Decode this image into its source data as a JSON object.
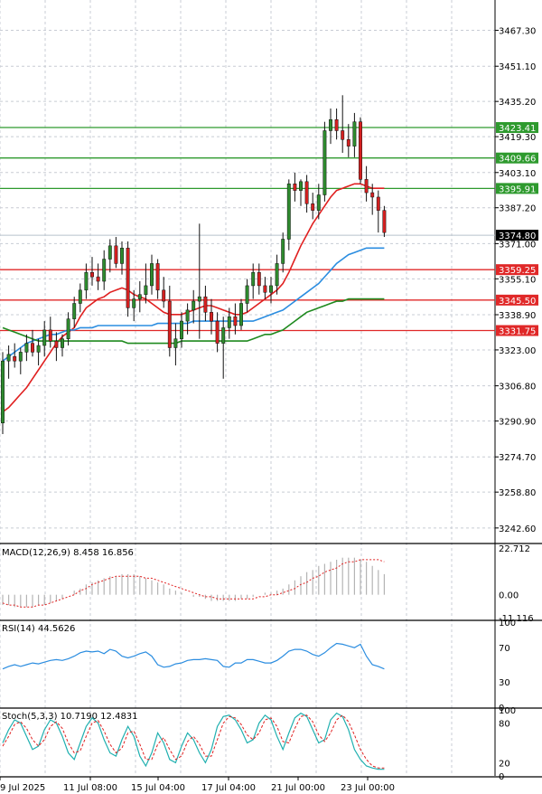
{
  "chart_data": {
    "type": "candlestick",
    "price_axis": {
      "ticks": [
        "3467.30",
        "3451.10",
        "3435.20",
        "3419.30",
        "3403.10",
        "3387.20",
        "3371.00",
        "3355.10",
        "3338.90",
        "3323.00",
        "3306.80",
        "3290.90",
        "3274.70",
        "3258.80",
        "3242.60"
      ],
      "min": 3236,
      "max": 3481
    },
    "current_price": "3374.80",
    "x_axis": {
      "labels": [
        "9 Jul 2025",
        "11 Jul 08:00",
        "15 Jul 04:00",
        "17 Jul 04:00",
        "21 Jul 00:00",
        "23 Jul 00:00"
      ]
    },
    "grid": true,
    "levels": [
      {
        "value": 3423.41,
        "label": "3423.41",
        "color": "#2e9a2e"
      },
      {
        "value": 3409.66,
        "label": "3409.66",
        "color": "#2e9a2e"
      },
      {
        "value": 3395.91,
        "label": "3395.91",
        "color": "#2e9a2e"
      },
      {
        "value": 3359.25,
        "label": "3359.25",
        "color": "#e02828"
      },
      {
        "value": 3345.5,
        "label": "3345.50",
        "color": "#e02828"
      },
      {
        "value": 3331.75,
        "label": "3331.75",
        "color": "#e02828"
      }
    ],
    "candles": [
      [
        3290,
        3322,
        3285,
        3318
      ],
      [
        3318,
        3325,
        3310,
        3321
      ],
      [
        3320,
        3326,
        3315,
        3318
      ],
      [
        3318,
        3324,
        3312,
        3322
      ],
      [
        3322,
        3330,
        3318,
        3326
      ],
      [
        3326,
        3332,
        3320,
        3322
      ],
      [
        3322,
        3328,
        3316,
        3325
      ],
      [
        3325,
        3336,
        3320,
        3332
      ],
      [
        3332,
        3338,
        3324,
        3327
      ],
      [
        3327,
        3331,
        3318,
        3324
      ],
      [
        3324,
        3330,
        3320,
        3328
      ],
      [
        3328,
        3340,
        3325,
        3337
      ],
      [
        3337,
        3347,
        3333,
        3344
      ],
      [
        3344,
        3353,
        3340,
        3350
      ],
      [
        3350,
        3362,
        3346,
        3358
      ],
      [
        3358,
        3365,
        3352,
        3356
      ],
      [
        3356,
        3362,
        3350,
        3354
      ],
      [
        3354,
        3368,
        3350,
        3364
      ],
      [
        3364,
        3373,
        3358,
        3370
      ],
      [
        3370,
        3374,
        3360,
        3362
      ],
      [
        3362,
        3372,
        3357,
        3369
      ],
      [
        3369,
        3372,
        3338,
        3342
      ],
      [
        3342,
        3350,
        3336,
        3346
      ],
      [
        3346,
        3354,
        3340,
        3348
      ],
      [
        3348,
        3362,
        3344,
        3352
      ],
      [
        3352,
        3366,
        3348,
        3362
      ],
      [
        3362,
        3364,
        3346,
        3350
      ],
      [
        3350,
        3356,
        3342,
        3345
      ],
      [
        3345,
        3352,
        3320,
        3324
      ],
      [
        3324,
        3335,
        3316,
        3328
      ],
      [
        3328,
        3340,
        3324,
        3336
      ],
      [
        3336,
        3344,
        3330,
        3341
      ],
      [
        3341,
        3350,
        3335,
        3345
      ],
      [
        3345,
        3380,
        3328,
        3347
      ],
      [
        3347,
        3352,
        3336,
        3340
      ],
      [
        3340,
        3346,
        3330,
        3336
      ],
      [
        3336,
        3340,
        3322,
        3326
      ],
      [
        3326,
        3338,
        3310,
        3333
      ],
      [
        3333,
        3342,
        3328,
        3338
      ],
      [
        3338,
        3344,
        3330,
        3334
      ],
      [
        3334,
        3346,
        3332,
        3344
      ],
      [
        3344,
        3355,
        3340,
        3352
      ],
      [
        3352,
        3362,
        3346,
        3358
      ],
      [
        3358,
        3362,
        3348,
        3352
      ],
      [
        3352,
        3356,
        3346,
        3349
      ],
      [
        3349,
        3356,
        3344,
        3352
      ],
      [
        3352,
        3366,
        3348,
        3362
      ],
      [
        3362,
        3376,
        3358,
        3373
      ],
      [
        3373,
        3400,
        3368,
        3398
      ],
      [
        3398,
        3403,
        3390,
        3395
      ],
      [
        3395,
        3400,
        3388,
        3399
      ],
      [
        3399,
        3402,
        3385,
        3389
      ],
      [
        3389,
        3394,
        3382,
        3386
      ],
      [
        3386,
        3398,
        3382,
        3393
      ],
      [
        3393,
        3426,
        3390,
        3422
      ],
      [
        3422,
        3432,
        3416,
        3427
      ],
      [
        3427,
        3432,
        3418,
        3422
      ],
      [
        3422,
        3438,
        3412,
        3418
      ],
      [
        3418,
        3425,
        3410,
        3415
      ],
      [
        3415,
        3430,
        3410,
        3426
      ],
      [
        3426,
        3428,
        3398,
        3400
      ],
      [
        3400,
        3406,
        3390,
        3394
      ],
      [
        3394,
        3398,
        3384,
        3392
      ],
      [
        3392,
        3395,
        3376,
        3386
      ],
      [
        3386,
        3388,
        3374,
        3376
      ]
    ],
    "ma_red": [
      3295,
      3297,
      3300,
      3303,
      3306,
      3310,
      3314,
      3318,
      3322,
      3326,
      3329,
      3331,
      3333,
      3338,
      3342,
      3344,
      3346,
      3347,
      3349,
      3350,
      3351,
      3350,
      3348,
      3347,
      3346,
      3344,
      3342,
      3340,
      3339,
      3339,
      3339,
      3340,
      3341,
      3342,
      3343,
      3343,
      3342,
      3341,
      3340,
      3339,
      3339,
      3340,
      3342,
      3344,
      3346,
      3348,
      3350,
      3353,
      3358,
      3364,
      3370,
      3375,
      3380,
      3384,
      3388,
      3392,
      3395,
      3396,
      3397,
      3398,
      3398,
      3397,
      3396,
      3396,
      3396
    ],
    "ma_blue": [
      3318,
      3320,
      3322,
      3324,
      3326,
      3327,
      3328,
      3329,
      3330,
      3330,
      3331,
      3332,
      3332,
      3333,
      3333,
      3333,
      3334,
      3334,
      3334,
      3334,
      3334,
      3334,
      3334,
      3334,
      3334,
      3334,
      3335,
      3335,
      3335,
      3335,
      3335,
      3335,
      3336,
      3336,
      3336,
      3336,
      3336,
      3336,
      3336,
      3336,
      3336,
      3336,
      3336,
      3337,
      3338,
      3339,
      3340,
      3341,
      3343,
      3345,
      3347,
      3349,
      3351,
      3353,
      3356,
      3359,
      3362,
      3364,
      3366,
      3367,
      3368,
      3369,
      3369,
      3369,
      3369
    ],
    "ma_green": [
      3333,
      3332,
      3331,
      3330,
      3329,
      3328,
      3327,
      3327,
      3327,
      3327,
      3327,
      3327,
      3327,
      3327,
      3327,
      3327,
      3327,
      3327,
      3327,
      3327,
      3327,
      3326,
      3326,
      3326,
      3326,
      3326,
      3326,
      3326,
      3326,
      3326,
      3327,
      3327,
      3327,
      3327,
      3327,
      3327,
      3327,
      3327,
      3327,
      3327,
      3327,
      3327,
      3328,
      3329,
      3330,
      3330,
      3331,
      3332,
      3334,
      3336,
      3338,
      3340,
      3341,
      3342,
      3343,
      3344,
      3345,
      3345,
      3346,
      3346,
      3346,
      3346,
      3346,
      3346,
      3346
    ],
    "macd": {
      "label": "MACD(12,26,9) 8.458 16.856",
      "ticks": [
        "22.712",
        "0.00",
        "-11.116"
      ],
      "min": -12,
      "max": 24,
      "hist": [
        -5,
        -5,
        -6,
        -6,
        -6,
        -6,
        -5,
        -5,
        -4,
        -3,
        -2,
        0,
        2,
        3,
        5,
        6,
        7,
        8,
        9,
        9,
        10,
        10,
        10,
        9,
        8,
        7,
        6,
        5,
        3,
        2,
        1,
        0,
        -1,
        -1,
        -2,
        -3,
        -3,
        -3,
        -3,
        -3,
        -2,
        -2,
        -1,
        0,
        1,
        1,
        2,
        3,
        5,
        7,
        9,
        11,
        12,
        14,
        15,
        16,
        17,
        18,
        18,
        18,
        17,
        16,
        14,
        12,
        10
      ],
      "signal": [
        -4,
        -5,
        -5,
        -6,
        -6,
        -6,
        -5,
        -5,
        -4,
        -3,
        -2,
        -1,
        0,
        2,
        3,
        5,
        6,
        7,
        8,
        9,
        9,
        9,
        9,
        9,
        8,
        8,
        7,
        6,
        5,
        4,
        3,
        2,
        1,
        0,
        -1,
        -1,
        -2,
        -2,
        -2,
        -2,
        -2,
        -2,
        -2,
        -1,
        -1,
        0,
        0,
        1,
        2,
        3,
        5,
        6,
        8,
        9,
        11,
        12,
        13,
        15,
        16,
        16,
        17,
        17,
        17,
        17,
        16
      ]
    },
    "rsi": {
      "label": "RSI(14) 44.5626",
      "ticks": [
        "100",
        "70",
        "30",
        "0"
      ],
      "min": 0,
      "max": 100,
      "values": [
        45,
        48,
        50,
        48,
        50,
        52,
        51,
        53,
        55,
        56,
        55,
        57,
        60,
        64,
        66,
        65,
        66,
        63,
        68,
        66,
        60,
        58,
        60,
        63,
        65,
        60,
        50,
        47,
        48,
        51,
        52,
        55,
        56,
        56,
        57,
        56,
        55,
        48,
        47,
        52,
        52,
        56,
        56,
        54,
        52,
        52,
        55,
        60,
        66,
        68,
        68,
        66,
        62,
        60,
        64,
        70,
        75,
        74,
        72,
        70,
        74,
        60,
        50,
        48,
        45
      ]
    },
    "stoch": {
      "label": "Stoch(5,3,3) 10.7190 12.4831",
      "ticks": [
        "100",
        "80",
        "20",
        "0"
      ],
      "min": 0,
      "max": 100,
      "k": [
        50,
        70,
        85,
        80,
        60,
        40,
        45,
        70,
        85,
        80,
        60,
        35,
        25,
        50,
        75,
        88,
        80,
        55,
        35,
        30,
        55,
        75,
        60,
        30,
        15,
        35,
        65,
        50,
        25,
        20,
        45,
        65,
        55,
        35,
        20,
        40,
        75,
        90,
        92,
        85,
        70,
        50,
        55,
        80,
        92,
        85,
        60,
        40,
        65,
        88,
        95,
        90,
        70,
        50,
        55,
        85,
        95,
        90,
        70,
        40,
        25,
        15,
        12,
        10,
        10
      ],
      "d": [
        45,
        60,
        78,
        82,
        72,
        55,
        45,
        55,
        75,
        82,
        72,
        50,
        35,
        38,
        60,
        80,
        84,
        68,
        48,
        35,
        42,
        65,
        68,
        48,
        25,
        25,
        48,
        58,
        40,
        25,
        30,
        52,
        60,
        48,
        30,
        30,
        55,
        80,
        90,
        88,
        78,
        62,
        55,
        65,
        85,
        88,
        75,
        52,
        50,
        72,
        90,
        92,
        82,
        62,
        52,
        65,
        85,
        92,
        82,
        62,
        40,
        25,
        15,
        12,
        12
      ]
    }
  }
}
